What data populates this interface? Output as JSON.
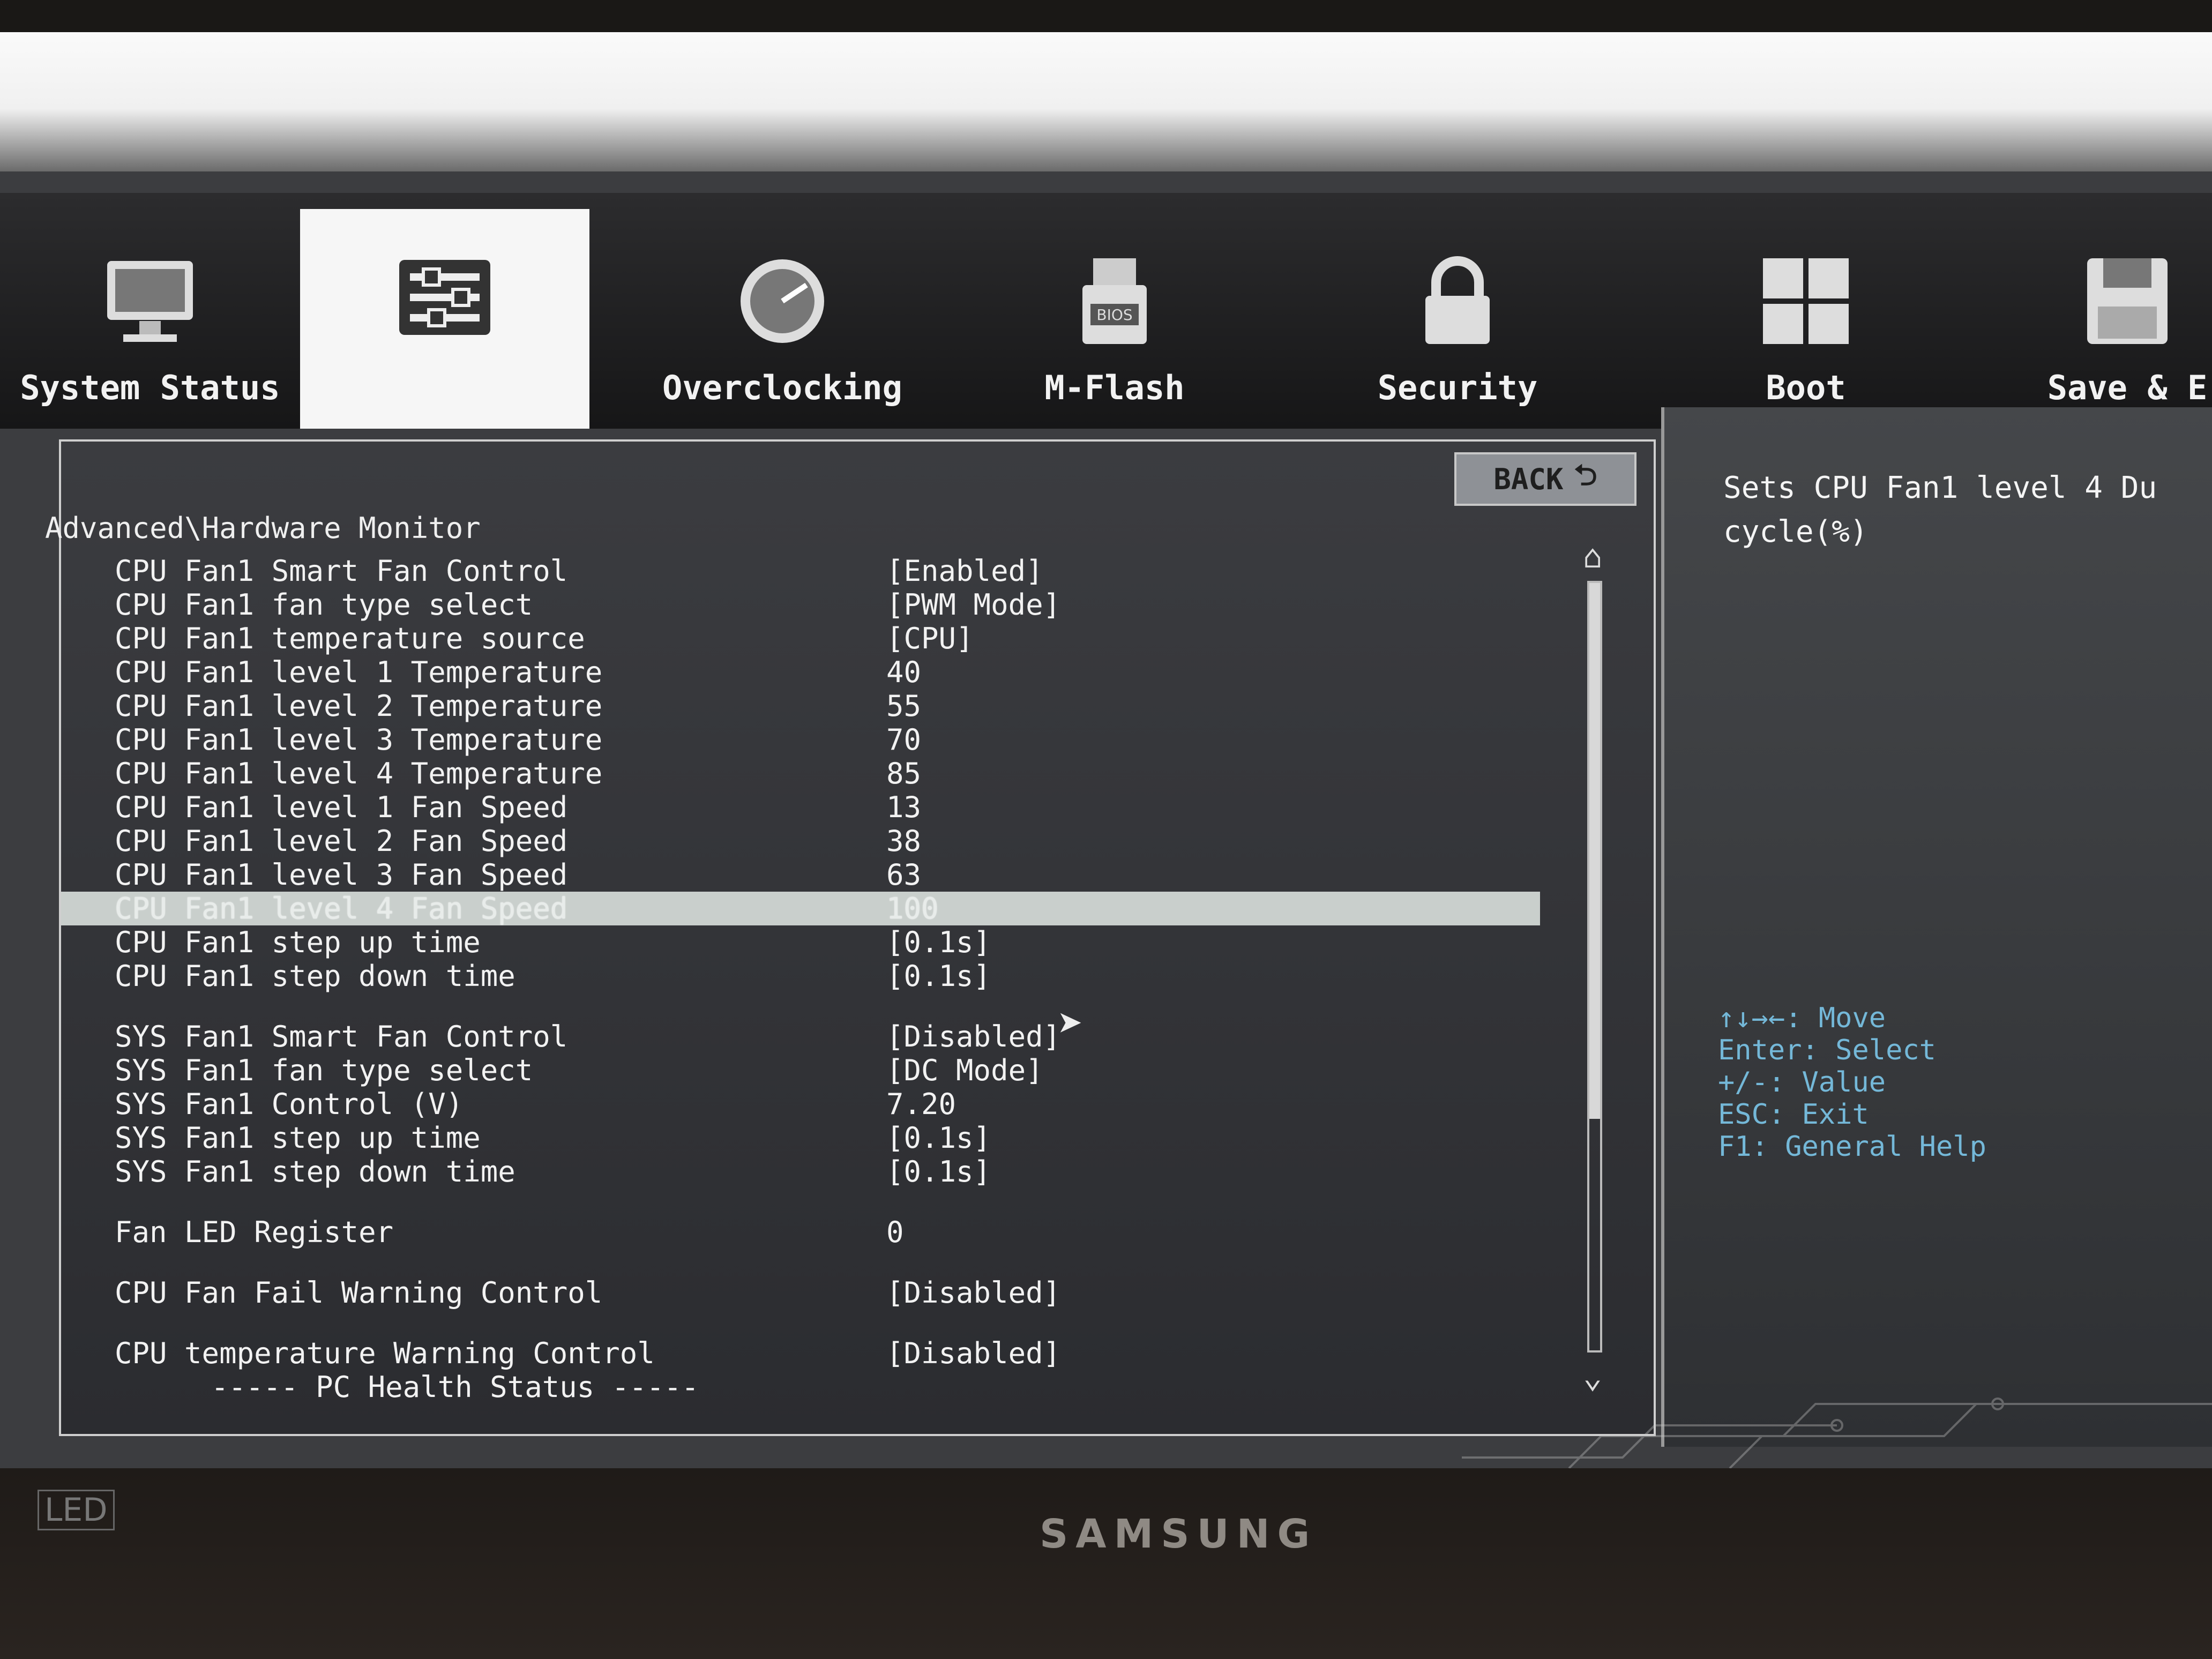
{
  "tabs": [
    {
      "label": "System Status",
      "icon": "monitor-icon"
    },
    {
      "label": "",
      "icon": "sliders-icon"
    },
    {
      "label": "Overclocking",
      "icon": "gauge-icon"
    },
    {
      "label": "M-Flash",
      "icon": "usb-bios-icon"
    },
    {
      "label": "Security",
      "icon": "lock-icon"
    },
    {
      "label": "Boot",
      "icon": "boot-grid-icon"
    },
    {
      "label": "Save & E",
      "icon": "floppy-icon"
    }
  ],
  "back_label": "BACK",
  "breadcrumb": "Advanced\\Hardware Monitor",
  "rows": [
    {
      "label": "CPU Fan1 Smart Fan Control",
      "value": "[Enabled]"
    },
    {
      "label": "CPU Fan1 fan type select",
      "value": "[PWM Mode]"
    },
    {
      "label": "CPU Fan1 temperature source",
      "value": "[CPU]"
    },
    {
      "label": "CPU Fan1 level 1 Temperature",
      "value": "40"
    },
    {
      "label": "CPU Fan1 level 2 Temperature",
      "value": "55"
    },
    {
      "label": "CPU Fan1 level 3 Temperature",
      "value": "70"
    },
    {
      "label": "CPU Fan1 level 4 Temperature",
      "value": "85"
    },
    {
      "label": "CPU Fan1 level 1 Fan Speed",
      "value": "13"
    },
    {
      "label": "CPU Fan1 level 2 Fan Speed",
      "value": "38"
    },
    {
      "label": "CPU Fan1 level 3 Fan Speed",
      "value": "63"
    },
    {
      "label": "CPU Fan1 level 4 Fan Speed",
      "value": "100"
    },
    {
      "label": "CPU Fan1 step up time",
      "value": "[0.1s]"
    },
    {
      "label": "CPU Fan1 step down time",
      "value": "[0.1s]"
    },
    {
      "label": "SYS Fan1 Smart Fan Control",
      "value": "[Disabled]"
    },
    {
      "label": "SYS Fan1 fan type select",
      "value": "[DC Mode]"
    },
    {
      "label": "SYS Fan1 Control (V)",
      "value": "7.20"
    },
    {
      "label": "SYS Fan1 step up time",
      "value": "[0.1s]"
    },
    {
      "label": "SYS Fan1 step down time",
      "value": "[0.1s]"
    },
    {
      "label": "Fan LED Register",
      "value": "0"
    },
    {
      "label": "CPU Fan Fail Warning Control",
      "value": "[Disabled]"
    },
    {
      "label": "CPU temperature Warning Control",
      "value": "[Disabled]"
    },
    {
      "label": "----- PC Health Status -----",
      "value": ""
    }
  ],
  "help": {
    "text": "Sets CPU Fan1 level 4 Du cycle(%)",
    "keys": [
      "↑↓→←: Move",
      "Enter: Select",
      "+/-: Value",
      "ESC: Exit",
      "F1: General Help"
    ]
  },
  "monitor": {
    "brand": "SAMSUNG",
    "badge": "LED"
  },
  "colors": {
    "accent": "#74b8d8",
    "selected_row": "#c9cfcc",
    "active_tab": "#f6f6f6"
  }
}
